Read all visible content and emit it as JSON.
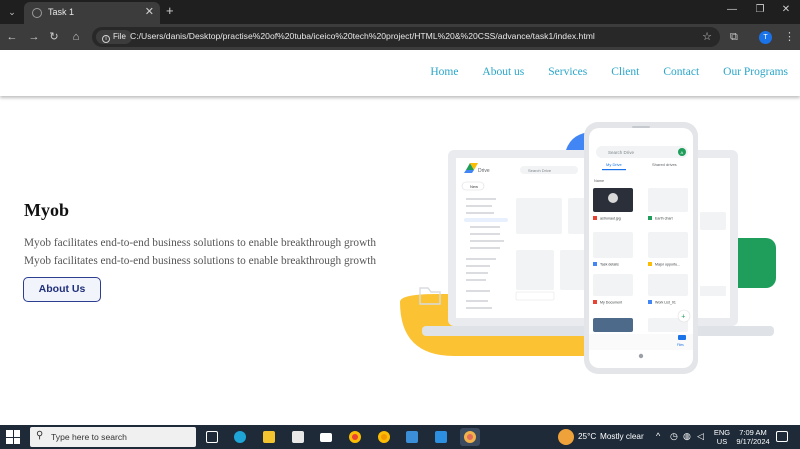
{
  "browser": {
    "tab_title": "Task 1",
    "file_chip": "File",
    "url": "C:/Users/danis/Desktop/practise%20of%20tuba/iceico%20tech%20project/HTML%20&%20CSS/advance/task1/index.html",
    "profile_initial": "T"
  },
  "nav": {
    "items": [
      "Home",
      "About us",
      "Services",
      "Client",
      "Contact",
      "Our Programs"
    ]
  },
  "hero": {
    "title": "Myob",
    "line1": "Myob facilitates end-to-end business solutions to enable breakthrough growth",
    "line2": "Myob facilitates end-to-end business solutions to enable breakthrough growth",
    "button": "About Us"
  },
  "illustration": {
    "drive_label": "Drive",
    "search_placeholder": "Search Drive",
    "new_label": "New",
    "tab_my_drive": "My Drive",
    "tab_shared": "Shared drives",
    "sort_label": "Name",
    "files": [
      "astronaut.jpg",
      "Earth chart",
      "Task details",
      "Major opportu...",
      "My Document",
      "Work List_01"
    ],
    "bottom_tab": "Files",
    "avatar_initial": "A",
    "colors": {
      "blue": "#4285f4",
      "green": "#1e9e5a",
      "yellow": "#fbbc04",
      "red": "#ea4335"
    }
  },
  "taskbar": {
    "search_placeholder": "Type here to search",
    "temperature": "25°C",
    "weather": "Mostly clear",
    "lang1": "ENG",
    "lang2": "US",
    "time": "7:09 AM",
    "date": "9/17/2024"
  }
}
